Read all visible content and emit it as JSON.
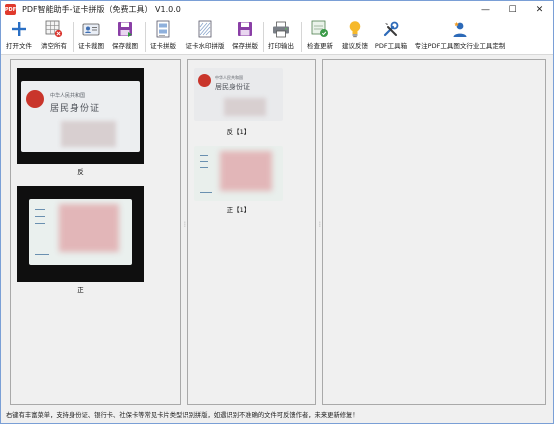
{
  "window": {
    "title": "PDF智能助手-证卡拼版（免费工具） V1.0.0",
    "icon_text": "PDF",
    "minimize_glyph": "—",
    "maximize_glyph": "☐",
    "close_glyph": "✕"
  },
  "toolbar": {
    "items": [
      {
        "label": "打开文件",
        "icon": "plus-icon"
      },
      {
        "label": "清空所有",
        "icon": "clear-grid-icon"
      },
      {
        "label": "证卡裁图",
        "icon": "id-card-crop-icon"
      },
      {
        "label": "保存裁图",
        "icon": "save-crop-icon"
      },
      {
        "label": "证卡拼版",
        "icon": "document-layout-icon"
      },
      {
        "label": "证卡水印拼版",
        "icon": "watermark-document-icon"
      },
      {
        "label": "保存拼版",
        "icon": "save-layout-icon"
      },
      {
        "label": "打印输出",
        "icon": "printer-icon"
      },
      {
        "label": "检查更新",
        "icon": "update-check-icon"
      },
      {
        "label": "建议反馈",
        "icon": "lightbulb-icon"
      },
      {
        "label": "PDF工具箱",
        "icon": "tools-icon"
      },
      {
        "label": "专注PDF工具图文行业工具定制",
        "icon": "user-service-icon"
      }
    ]
  },
  "left_panel": {
    "images": [
      {
        "caption": "反",
        "side": "back",
        "card_title_small": "中华人民共和国",
        "card_title_large": "居民身份证"
      },
      {
        "caption": "正",
        "side": "front"
      }
    ]
  },
  "middle_panel": {
    "images": [
      {
        "caption": "反【1】",
        "side": "back",
        "card_title_small": "中华人民共和国",
        "card_title_large": "居民身份证"
      },
      {
        "caption": "正【1】",
        "side": "front"
      }
    ]
  },
  "splitter_glyph": "⋮",
  "status": {
    "text": "右键有丰富菜单，支持身份证、银行卡、社保卡等常见卡片类型识别拼版，如遇识别不准确的文件可反馈作者，未来更新修复！"
  }
}
